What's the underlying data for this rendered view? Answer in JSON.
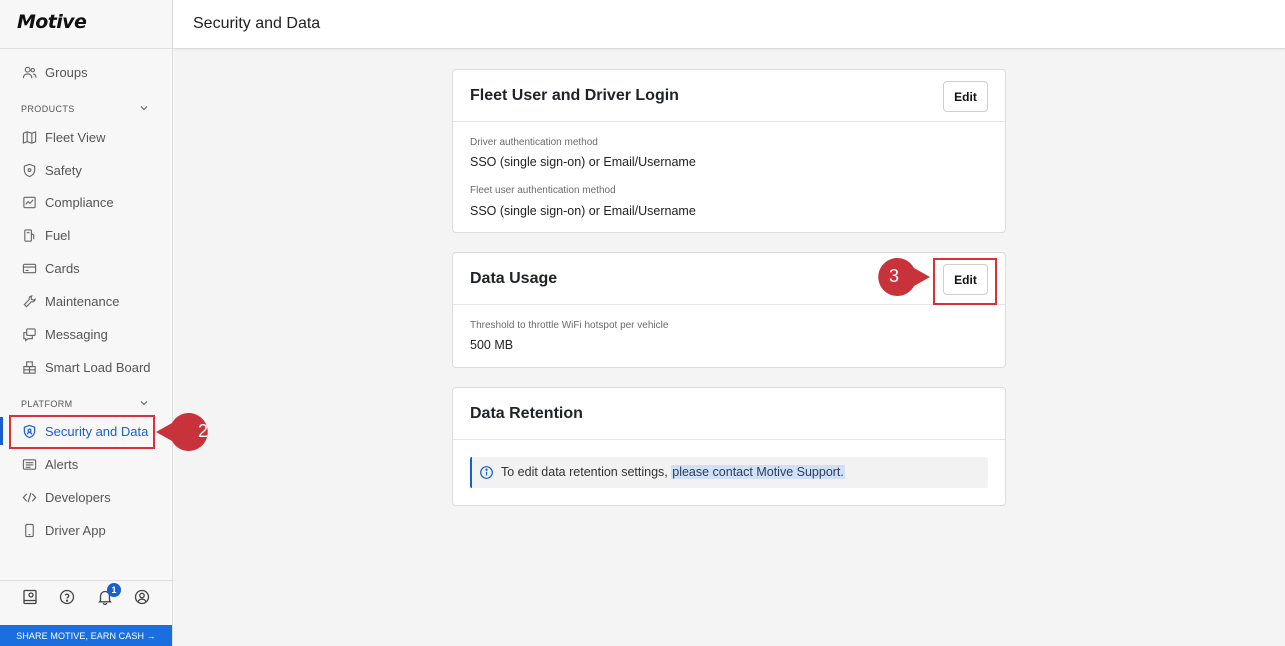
{
  "app": {
    "logo": "Motive"
  },
  "sidebar": {
    "groups_label": "Groups",
    "products_label": "PRODUCTS",
    "products": [
      {
        "label": "Fleet View",
        "icon": "map-icon"
      },
      {
        "label": "Safety",
        "icon": "shield-icon"
      },
      {
        "label": "Compliance",
        "icon": "compliance-icon"
      },
      {
        "label": "Fuel",
        "icon": "fuel-icon"
      },
      {
        "label": "Cards",
        "icon": "card-icon"
      },
      {
        "label": "Maintenance",
        "icon": "maintenance-icon"
      },
      {
        "label": "Messaging",
        "icon": "messaging-icon"
      },
      {
        "label": "Smart Load Board",
        "icon": "load-board-icon"
      }
    ],
    "platform_label": "PLATFORM",
    "platform": [
      {
        "label": "Security and Data",
        "icon": "security-icon",
        "active": true
      },
      {
        "label": "Alerts",
        "icon": "alerts-icon"
      },
      {
        "label": "Developers",
        "icon": "code-icon"
      },
      {
        "label": "Driver App",
        "icon": "phone-icon"
      }
    ],
    "notification_count": "1",
    "share_label": "SHARE MOTIVE, EARN CASH →"
  },
  "header": {
    "title": "Security and Data"
  },
  "cards": {
    "login": {
      "title": "Fleet User and Driver Login",
      "edit_label": "Edit",
      "driver_auth_label": "Driver authentication method",
      "driver_auth_value": "SSO (single sign-on) or Email/Username",
      "fleet_auth_label": "Fleet user authentication method",
      "fleet_auth_value": "SSO (single sign-on) or Email/Username"
    },
    "usage": {
      "title": "Data Usage",
      "edit_label": "Edit",
      "threshold_label": "Threshold to throttle WiFi hotspot per vehicle",
      "threshold_value": "500 MB"
    },
    "retention": {
      "title": "Data Retention",
      "info_text": "To edit data retention settings, ",
      "info_link": "please contact Motive Support."
    }
  },
  "annotations": {
    "step2": "2",
    "step3": "3"
  },
  "colors": {
    "accent": "#1a5fd0",
    "callout": "#c8323a",
    "share_bar": "#1a6ee0"
  }
}
